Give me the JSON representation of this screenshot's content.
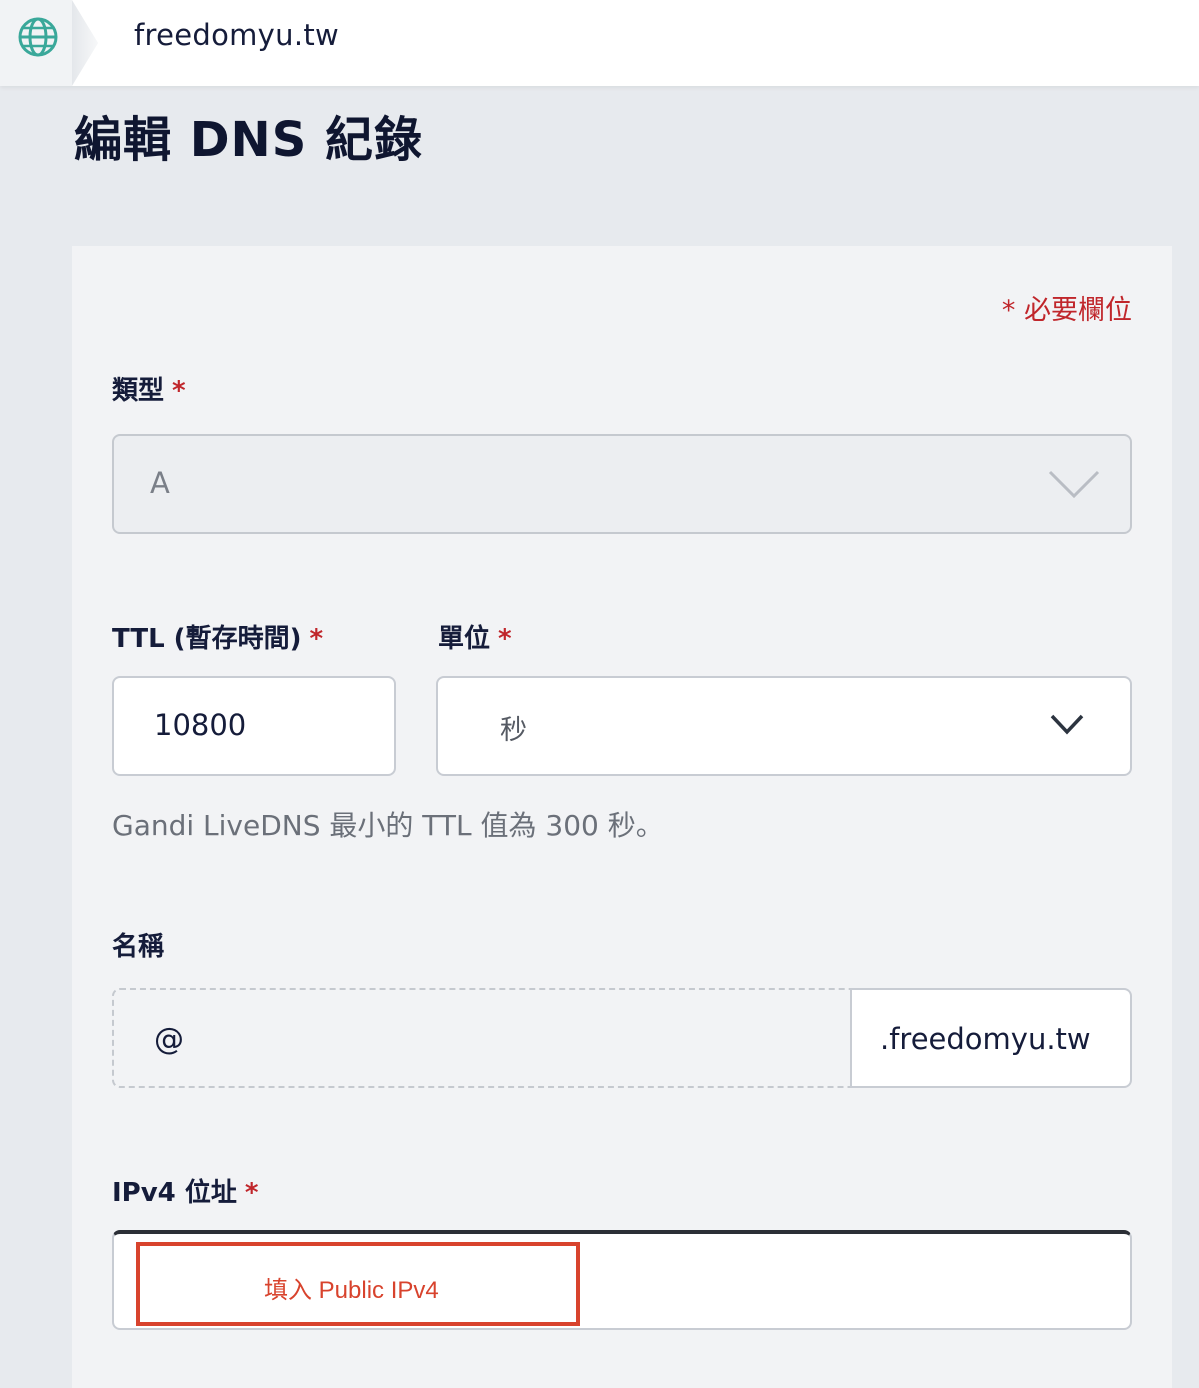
{
  "header": {
    "domain": "freedomyu.tw",
    "globe_icon": "globe-icon",
    "accent_color": "#3aa89a"
  },
  "page": {
    "title": "編輯 DNS 紀錄"
  },
  "form": {
    "required_note": "* 必要欄位",
    "required_star": "*",
    "type": {
      "label": "類型",
      "value": "A"
    },
    "ttl": {
      "label": "TTL (暫存時間)",
      "value": "10800"
    },
    "unit": {
      "label": "單位",
      "value": "秒"
    },
    "ttl_hint": "Gandi LiveDNS 最小的 TTL 值為 300 秒。",
    "name": {
      "label": "名稱",
      "value": "@",
      "suffix": ".freedomyu.tw"
    },
    "ipv4": {
      "label": "IPv4 位址",
      "annotation": "填入 Public IPv4",
      "annotation_color": "#d8432d"
    }
  }
}
